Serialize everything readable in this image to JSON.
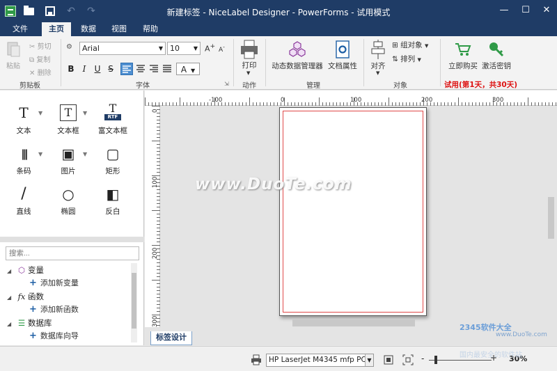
{
  "titlebar": {
    "title": "新建标签 - NiceLabel Designer - PowerForms - 试用模式",
    "minimize": "—",
    "maximize": "☐",
    "close": "✕",
    "undo": "↶",
    "redo": "↷"
  },
  "menu": {
    "tabs": [
      {
        "label": "文件"
      },
      {
        "label": "主页"
      },
      {
        "label": "数据"
      },
      {
        "label": "视图"
      },
      {
        "label": "帮助"
      }
    ]
  },
  "ribbon": {
    "clipboard": {
      "paste": "粘贴",
      "cut": "剪切",
      "copy": "复制",
      "delete": "删除",
      "label": "剪贴板"
    },
    "font": {
      "family": "Arial",
      "size": "10",
      "label": "字体",
      "bold": "B",
      "italic": "I",
      "underline": "U",
      "strike": "S",
      "color_btn": "A"
    },
    "action": {
      "print": "打印",
      "label": "动作"
    },
    "manage": {
      "dynamic_data": "动态数据管理器",
      "doc_props": "文档属性",
      "label": "管理"
    },
    "object": {
      "align": "对齐",
      "group": "组对象",
      "arrange": "排列",
      "label": "对象"
    },
    "buy": {
      "buy_now": "立即购买",
      "activate": "激活密钥",
      "trial": "试用(第1天，共30天)"
    }
  },
  "tools": {
    "items": [
      {
        "label": "文本",
        "glyph": "T"
      },
      {
        "label": "文本框",
        "glyph": "T"
      },
      {
        "label": "富文本框",
        "glyph": "T"
      },
      {
        "label": "条码",
        "glyph": "|||"
      },
      {
        "label": "图片",
        "glyph": "▣"
      },
      {
        "label": "矩形",
        "glyph": "▢"
      },
      {
        "label": "直线",
        "glyph": "/"
      },
      {
        "label": "椭圆",
        "glyph": "○"
      },
      {
        "label": "反白",
        "glyph": "◧"
      }
    ],
    "rtf_badge": "RTF"
  },
  "panel": {
    "search_placeholder": "搜索...",
    "tree": [
      {
        "label": "变量",
        "child": "添加新变量"
      },
      {
        "label": "函数",
        "child": "添加新函数"
      },
      {
        "label": "数据库",
        "child": "数据库向导"
      }
    ]
  },
  "designer": {
    "tab_label": "标签设计",
    "ruler_h": [
      "-100",
      "0",
      "100",
      "200",
      "300"
    ],
    "ruler_v": [
      "0",
      "100",
      "200",
      "300"
    ]
  },
  "status": {
    "printer": "HP LaserJet M4345 mfp PCL6",
    "zoom_minus": "-",
    "zoom_plus": "+",
    "zoom": "30%"
  },
  "watermarks": {
    "main": "www.DuoTe.com",
    "brand": "2345软件大全",
    "url": "www.DuoTe.com",
    "tagline": "国内最安全的软件站"
  }
}
